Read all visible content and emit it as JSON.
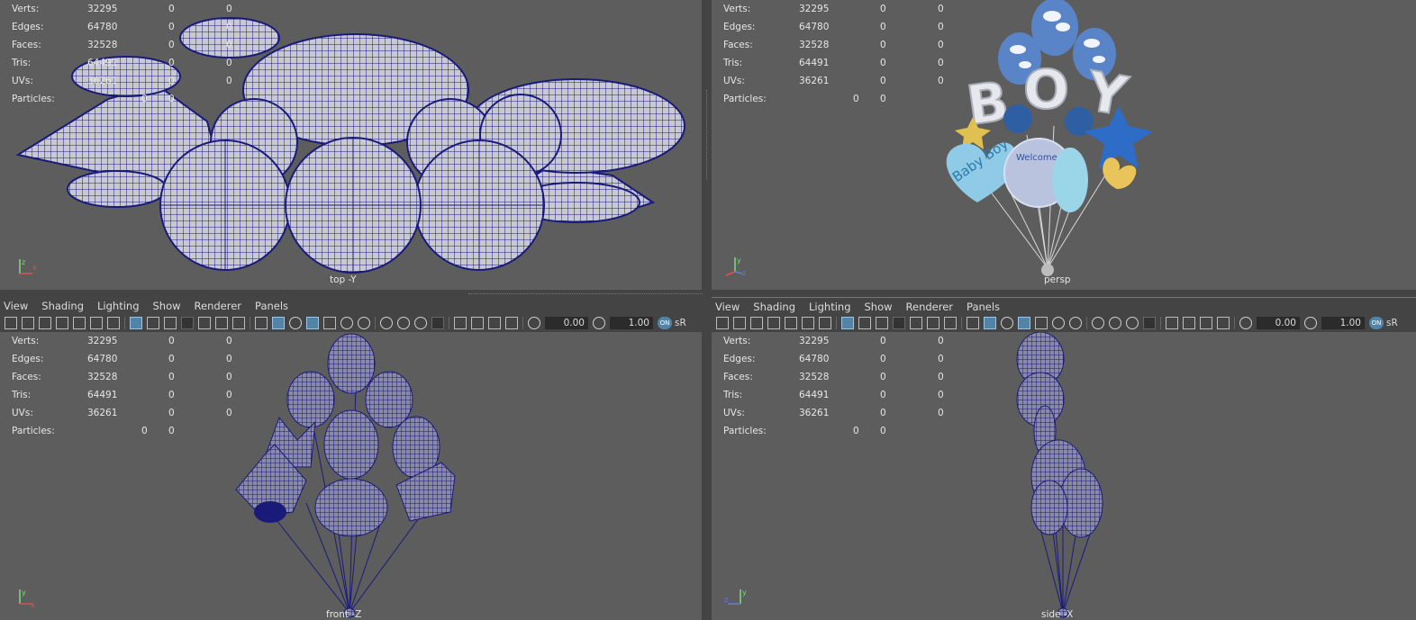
{
  "menu": [
    "View",
    "Shading",
    "Lighting",
    "Show",
    "Renderer",
    "Panels"
  ],
  "toolbar": {
    "exposure": "0.00",
    "gamma": "1.00",
    "ocio_badge": "ON",
    "colorspace_label": "sR"
  },
  "stats": {
    "labels": {
      "verts": "Verts:",
      "edges": "Edges:",
      "faces": "Faces:",
      "tris": "Tris:",
      "uvs": "UVs:",
      "particles": "Particles:"
    },
    "verts": [
      "32295",
      "0",
      "0"
    ],
    "edges": [
      "64780",
      "0",
      "0"
    ],
    "faces": [
      "32528",
      "0",
      "0"
    ],
    "tris": [
      "64491",
      "0",
      "0"
    ],
    "uvs": [
      "36261",
      "0",
      "0"
    ],
    "particles": [
      "0",
      "0"
    ]
  },
  "viewports": {
    "top": {
      "camera_label": "top -Y"
    },
    "persp": {
      "camera_label": "persp"
    },
    "front": {
      "camera_label": "front -Z"
    },
    "side": {
      "camera_label": "side -X"
    }
  },
  "balloon_text": {
    "letters": [
      "B",
      "O",
      "Y"
    ],
    "heart_text": "Baby Boy",
    "center_text": "Welcome"
  },
  "colors": {
    "wire": "#1a1a7a",
    "viewport_bg": "#5d5d5d",
    "panel_bg": "#444444",
    "accent": "#5284a8"
  }
}
